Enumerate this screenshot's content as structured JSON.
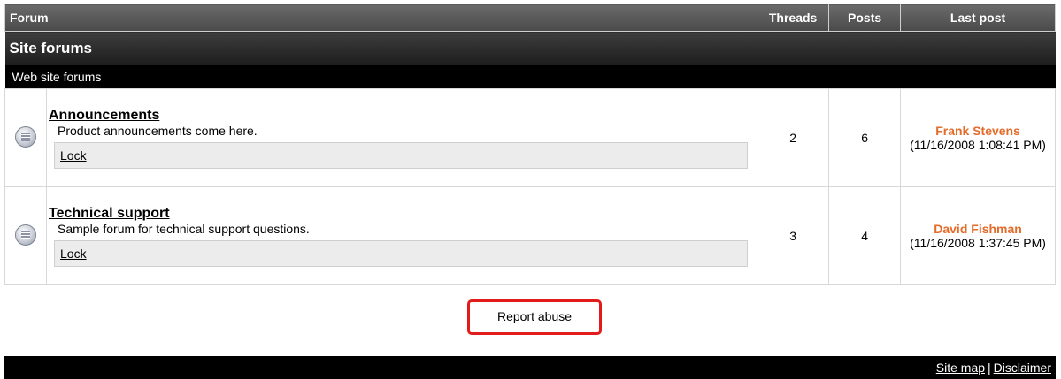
{
  "columns": {
    "forum": "Forum",
    "threads": "Threads",
    "posts": "Posts",
    "last_post": "Last post"
  },
  "group": {
    "title": "Site forums",
    "description": "Web site forums"
  },
  "forums": [
    {
      "title": "Announcements",
      "description": "Product announcements come here.",
      "lock": "Lock",
      "threads": "2",
      "posts": "6",
      "last_author": "Frank Stevens",
      "last_time": "(11/16/2008 1:08:41 PM)"
    },
    {
      "title": "Technical support",
      "description": "Sample forum for technical support questions.",
      "lock": "Lock",
      "threads": "3",
      "posts": "4",
      "last_author": "David Fishman",
      "last_time": "(11/16/2008 1:37:45 PM)"
    }
  ],
  "report_abuse": "Report abuse",
  "footer": {
    "site_map": "Site map",
    "separator": "|",
    "disclaimer": "Disclaimer"
  },
  "colors": {
    "author": "#e46b2a",
    "highlight": "#e21b1b"
  }
}
